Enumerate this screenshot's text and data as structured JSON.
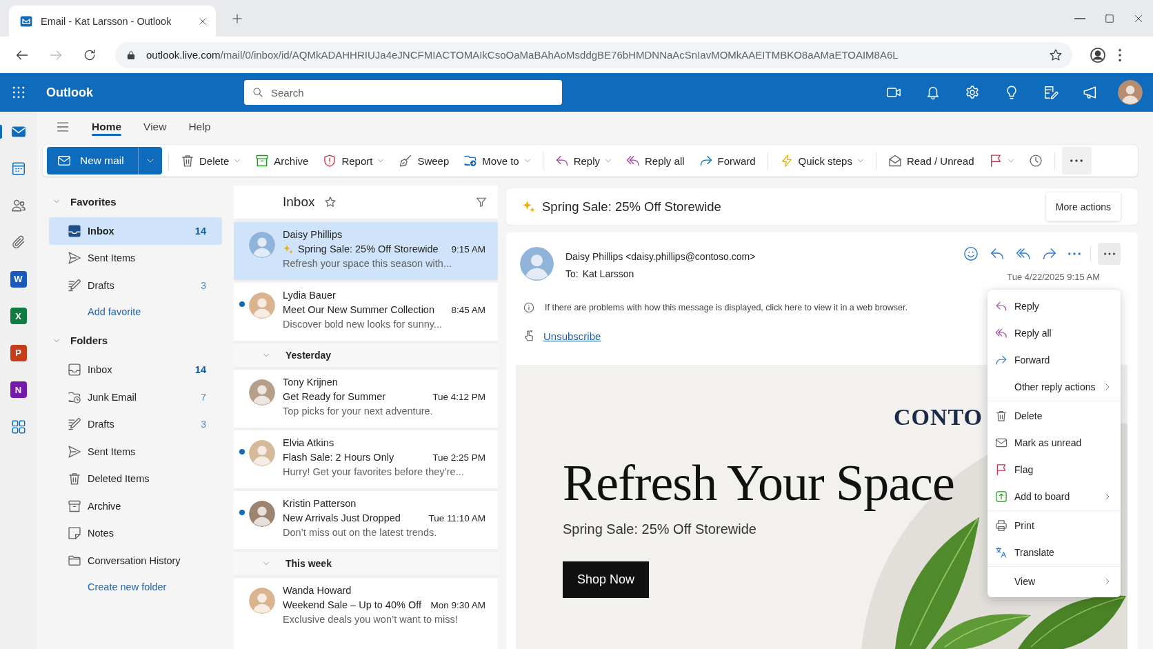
{
  "browser": {
    "tab": {
      "title": "Email - Kat Larsson - Outlook"
    },
    "forward_enabled": false,
    "url": {
      "host": "outlook.live.com",
      "path": "/mail/0/inbox/id/AQMkADAHHRIUJa4eJNCFMIACTOMAIkCsoOaMaBAhAoMsddgBE76bHMDNNaAcSnIavMOMkAAEITMBKO8aAMaETOAIM8A6L"
    }
  },
  "app_bar": {
    "title": "Outlook",
    "search": {
      "placeholder": "Search"
    }
  },
  "nav_rail": [
    {
      "kind": "mail",
      "selected": true
    },
    {
      "kind": "calendar",
      "selected": false
    },
    {
      "kind": "people",
      "selected": false
    },
    {
      "kind": "files",
      "selected": false
    },
    {
      "kind": "app",
      "letter": "W",
      "color": "#185abd",
      "selected": false
    },
    {
      "kind": "app",
      "letter": "X",
      "color": "#107c41",
      "selected": false
    },
    {
      "kind": "app",
      "letter": "P",
      "color": "#c43e1c",
      "selected": false
    },
    {
      "kind": "app",
      "letter": "N",
      "color": "#7719aa",
      "selected": false
    },
    {
      "kind": "apps",
      "selected": false
    }
  ],
  "tabs": [
    {
      "label": "Home",
      "selected": true
    },
    {
      "label": "View",
      "selected": false
    },
    {
      "label": "Help",
      "selected": false
    }
  ],
  "ribbon": {
    "new_mail": "New mail",
    "groups": [
      [
        {
          "kind": "delete",
          "label": "Delete",
          "dropdown": true
        },
        {
          "kind": "archive",
          "label": "Archive",
          "dropdown": false
        },
        {
          "kind": "report",
          "label": "Report",
          "dropdown": true
        },
        {
          "kind": "sweep",
          "label": "Sweep",
          "dropdown": false
        },
        {
          "kind": "move",
          "label": "Move to",
          "dropdown": true
        }
      ],
      [
        {
          "kind": "reply",
          "label": "Reply",
          "dropdown": true
        },
        {
          "kind": "reply_all",
          "label": "Reply all",
          "dropdown": false
        },
        {
          "kind": "forward",
          "label": "Forward",
          "dropdown": false
        }
      ],
      [
        {
          "kind": "quick_steps",
          "label": "Quick steps",
          "dropdown": true
        }
      ],
      [
        {
          "kind": "read_unread",
          "label": "Read / Unread",
          "dropdown": false
        },
        {
          "kind": "flag",
          "dropdown": true
        },
        {
          "kind": "snooze",
          "dropdown": false
        }
      ]
    ]
  },
  "folders": [
    {
      "label": "Favorites",
      "expanded": true,
      "items": [
        {
          "kind": "inbox",
          "label": "Inbox",
          "count": "14",
          "count_unread": true,
          "selected": true
        },
        {
          "kind": "sent",
          "label": "Sent Items",
          "selected": false
        },
        {
          "kind": "drafts",
          "label": "Drafts",
          "count": "3",
          "count_unread": false,
          "selected": false
        }
      ],
      "action": "Add favorite"
    },
    {
      "label": "Folders",
      "expanded": true,
      "items": [
        {
          "kind": "inbox",
          "label": "Inbox",
          "count": "14",
          "count_unread": true,
          "selected": false
        },
        {
          "kind": "junk",
          "label": "Junk Email",
          "count": "7",
          "count_unread": false,
          "selected": false
        },
        {
          "kind": "drafts",
          "label": "Drafts",
          "count": "3",
          "count_unread": false,
          "selected": false
        },
        {
          "kind": "sent",
          "label": "Sent Items",
          "selected": false
        },
        {
          "kind": "deleted",
          "label": "Deleted Items",
          "selected": false
        },
        {
          "kind": "archive",
          "label": "Archive",
          "selected": false
        },
        {
          "kind": "notes",
          "label": "Notes",
          "selected": false
        },
        {
          "kind": "history",
          "label": "Conversation History",
          "selected": false
        }
      ],
      "action": "Create new folder"
    }
  ],
  "message_list": {
    "title": "Inbox",
    "items": [
      {
        "kind": "message",
        "sender": "Daisy Phillips",
        "subject": "Spring Sale: 25% Off Storewide",
        "time": "9:15 AM",
        "preview": "Refresh your space this season with...",
        "sparkle": true,
        "unread": false,
        "selected": true
      },
      {
        "kind": "message",
        "sender": "Lydia Bauer",
        "subject": "Meet Our New Summer Collection",
        "time": "8:45 AM",
        "preview": "Discover bold new looks for sunny...",
        "sparkle": false,
        "unread": true,
        "selected": false
      },
      {
        "kind": "group",
        "label": "Yesterday",
        "expanded": true
      },
      {
        "kind": "message",
        "sender": "Tony Krijnen",
        "subject": "Get Ready for Summer",
        "time": "Tue 4:12 PM",
        "preview": "Top picks for your next adventure.",
        "sparkle": false,
        "unread": false,
        "selected": false
      },
      {
        "kind": "message",
        "sender": "Elvia Atkins",
        "subject": "Flash Sale: 2 Hours Only",
        "time": "Tue 2:25 PM",
        "preview": "Hurry! Get your favorites before they’re...",
        "sparkle": false,
        "unread": true,
        "selected": false
      },
      {
        "kind": "message",
        "sender": "Kristin Patterson",
        "subject": "New Arrivals Just Dropped",
        "time": "Tue 11:10 AM",
        "preview": "Don’t miss out on the latest trends.",
        "sparkle": false,
        "unread": true,
        "selected": false
      },
      {
        "kind": "group",
        "label": "This week",
        "expanded": true
      },
      {
        "kind": "message",
        "sender": "Wanda Howard",
        "subject": "Weekend Sale – Up to 40% Off",
        "time": "Mon 9:30 AM",
        "preview": "Exclusive deals you won’t want to miss!",
        "sparkle": false,
        "unread": false,
        "selected": false
      }
    ]
  },
  "reading_pane": {
    "subject": "Spring Sale: 25% Off Storewide",
    "sparkle": true,
    "more_actions": "More actions",
    "message": {
      "from": "Daisy Phillips <daisy.phillips@contoso.com>",
      "to_label": "To:",
      "to": "Kat Larsson",
      "date": "Tue 4/22/2025 9:15 AM",
      "menu_open": true,
      "info": "If there are problems with how this message is displayed, click here to view it in a web browser.",
      "unsubscribe": "Unsubscribe",
      "body": {
        "brand": "CONTO",
        "headline": "Refresh Your Space",
        "subheadline": "Spring Sale: 25% Off Storewide",
        "button": "Shop Now"
      }
    }
  },
  "context_menu": {
    "groups": [
      [
        {
          "kind": "reply",
          "label": "Reply",
          "submenu": false
        },
        {
          "kind": "reply_all",
          "label": "Reply all",
          "submenu": false
        },
        {
          "kind": "forward",
          "label": "Forward",
          "submenu": false
        },
        {
          "kind": "plain",
          "label": "Other reply actions",
          "submenu": true
        }
      ],
      [
        {
          "kind": "delete",
          "label": "Delete",
          "submenu": false
        },
        {
          "kind": "mark_unread",
          "label": "Mark as unread",
          "submenu": false
        },
        {
          "kind": "flag",
          "label": "Flag",
          "submenu": false
        },
        {
          "kind": "board",
          "label": "Add to board",
          "submenu": true
        }
      ],
      [
        {
          "kind": "print",
          "label": "Print",
          "submenu": false
        },
        {
          "kind": "translate",
          "label": "Translate",
          "submenu": false
        }
      ],
      [
        {
          "kind": "plain",
          "label": "View",
          "submenu": true
        }
      ]
    ]
  }
}
